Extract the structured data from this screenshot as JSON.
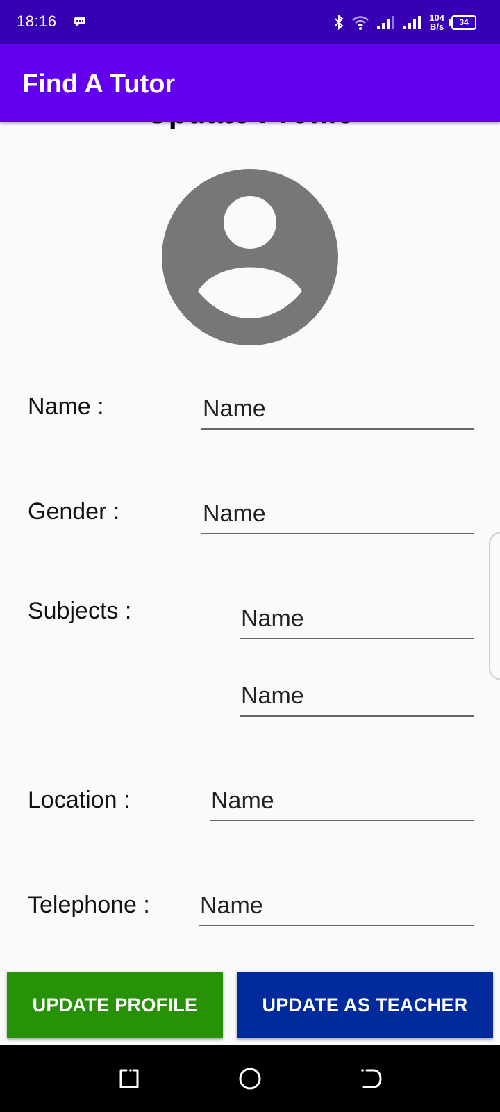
{
  "status_bar": {
    "time": "18:16",
    "net_speed_value": "104",
    "net_speed_unit": "B/s",
    "battery": "34",
    "icons": [
      "message-icon",
      "bluetooth-icon",
      "wifi-icon",
      "signal-icon",
      "signal-icon",
      "battery-icon"
    ]
  },
  "app_bar": {
    "title": "Find A Tutor"
  },
  "page": {
    "title": "Update Profile"
  },
  "form": {
    "name_label": "Name :",
    "name_value": "Name",
    "gender_label": "Gender :",
    "gender_value": "Name",
    "subjects_label": "Subjects :",
    "subject1_value": "Name",
    "subject2_value": "Name",
    "location_label": "Location :",
    "location_value": "Name",
    "telephone_label": "Telephone :",
    "telephone_value": "Name"
  },
  "buttons": {
    "update_profile": "UPDATE PROFILE",
    "update_as_teacher": "UPDATE AS TEACHER"
  },
  "colors": {
    "status_bar": "#3700b3",
    "app_bar": "#6200ee",
    "update_profile_button": "#279207",
    "update_teacher_button": "#012a9c",
    "avatar": "#777777"
  }
}
